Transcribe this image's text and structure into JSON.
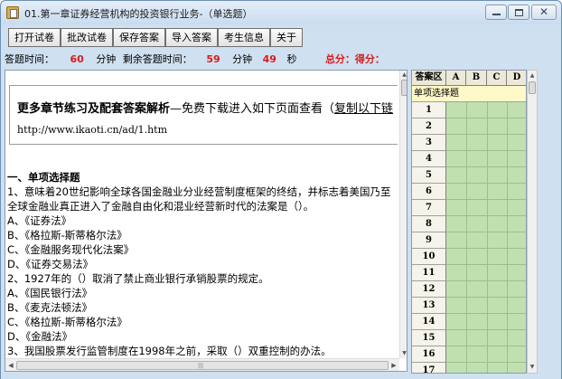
{
  "window": {
    "title": "01.第一章证券经营机构的投资银行业务-（单选题）",
    "min_symbol": "",
    "max_symbol": "",
    "close_symbol": "✕"
  },
  "toolbar": {
    "items": [
      "打开试卷",
      "批改试卷",
      "保存答案",
      "导入答案",
      "考生信息",
      "关于"
    ]
  },
  "timebar": {
    "answer_time_label": "答题时间：",
    "answer_time_value": "60",
    "minute_label_1": "分钟",
    "remaining_label": "剩余答题时间：",
    "remaining_min": "59",
    "minute_label_2": "分钟",
    "remaining_sec": "49",
    "second_label": "秒",
    "score_label": "总分：得分："
  },
  "ad": {
    "title_bold": "更多章节练习及配套答案解析",
    "title_sub": "—免费下载进入如下页面查看（",
    "title_link": "复制以下链",
    "url": "http://www.ikaoti.cn/ad/1.htm"
  },
  "questions": {
    "section_heading": "一、单项选择题",
    "lines": [
      "1、意味着20世纪影响全球各国金融业分业经营制度框架的终结，并标志着美国乃至",
      "全球金融业真正进入了金融自由化和混业经营新时代的法案是（）。",
      "A、《证券法》",
      "B、《格拉斯-斯蒂格尔法》",
      "C、《金融服务现代化法案》",
      "D、《证券交易法》",
      "2、1927年的（）取消了禁止商业银行承销股票的规定。",
      "A、《国民银行法》",
      "B、《麦克法顿法》",
      "C、《格拉斯-斯蒂格尔法》",
      "D、《金融法》",
      "3、我国股票发行监管制度在1998年之前，采取（）双重控制的办法。"
    ]
  },
  "answer_grid": {
    "header_label": "答案区",
    "columns": [
      "A",
      "B",
      "C",
      "D"
    ],
    "section_label": "单项选择题",
    "rows": [
      "1",
      "2",
      "3",
      "4",
      "5",
      "6",
      "7",
      "8",
      "9",
      "10",
      "11",
      "12",
      "13",
      "14",
      "15",
      "16",
      "17"
    ]
  },
  "icons": {
    "scroll_up": "▲",
    "scroll_down": "▼",
    "scroll_left": "◀",
    "scroll_right": "▶",
    "grip": "|||"
  }
}
